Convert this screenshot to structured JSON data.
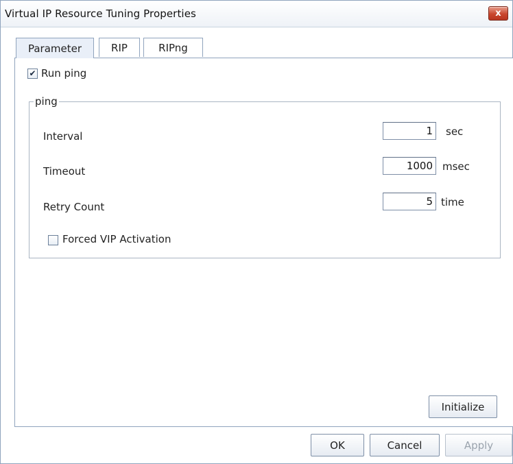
{
  "window": {
    "title": "Virtual IP Resource Tuning Properties",
    "close_icon": "close-icon",
    "close_glyph": "x"
  },
  "tabs": [
    {
      "label": "Parameter",
      "active": true
    },
    {
      "label": "RIP",
      "active": false
    },
    {
      "label": "RIPng",
      "active": false
    }
  ],
  "parameter": {
    "run_ping": {
      "label": "Run ping",
      "checked": true,
      "check_glyph": "✔"
    },
    "ping_group": {
      "title": "ping",
      "interval": {
        "label": "Interval",
        "value": "1",
        "unit": "sec"
      },
      "timeout": {
        "label": "Timeout",
        "value": "1000",
        "unit": "msec"
      },
      "retry_count": {
        "label": "Retry Count",
        "value": "5",
        "unit": "time"
      },
      "forced_vip": {
        "label": "Forced VIP Activation",
        "checked": false
      }
    },
    "initialize_label": "Initialize"
  },
  "footer": {
    "ok_label": "OK",
    "cancel_label": "Cancel",
    "apply_label": "Apply"
  }
}
